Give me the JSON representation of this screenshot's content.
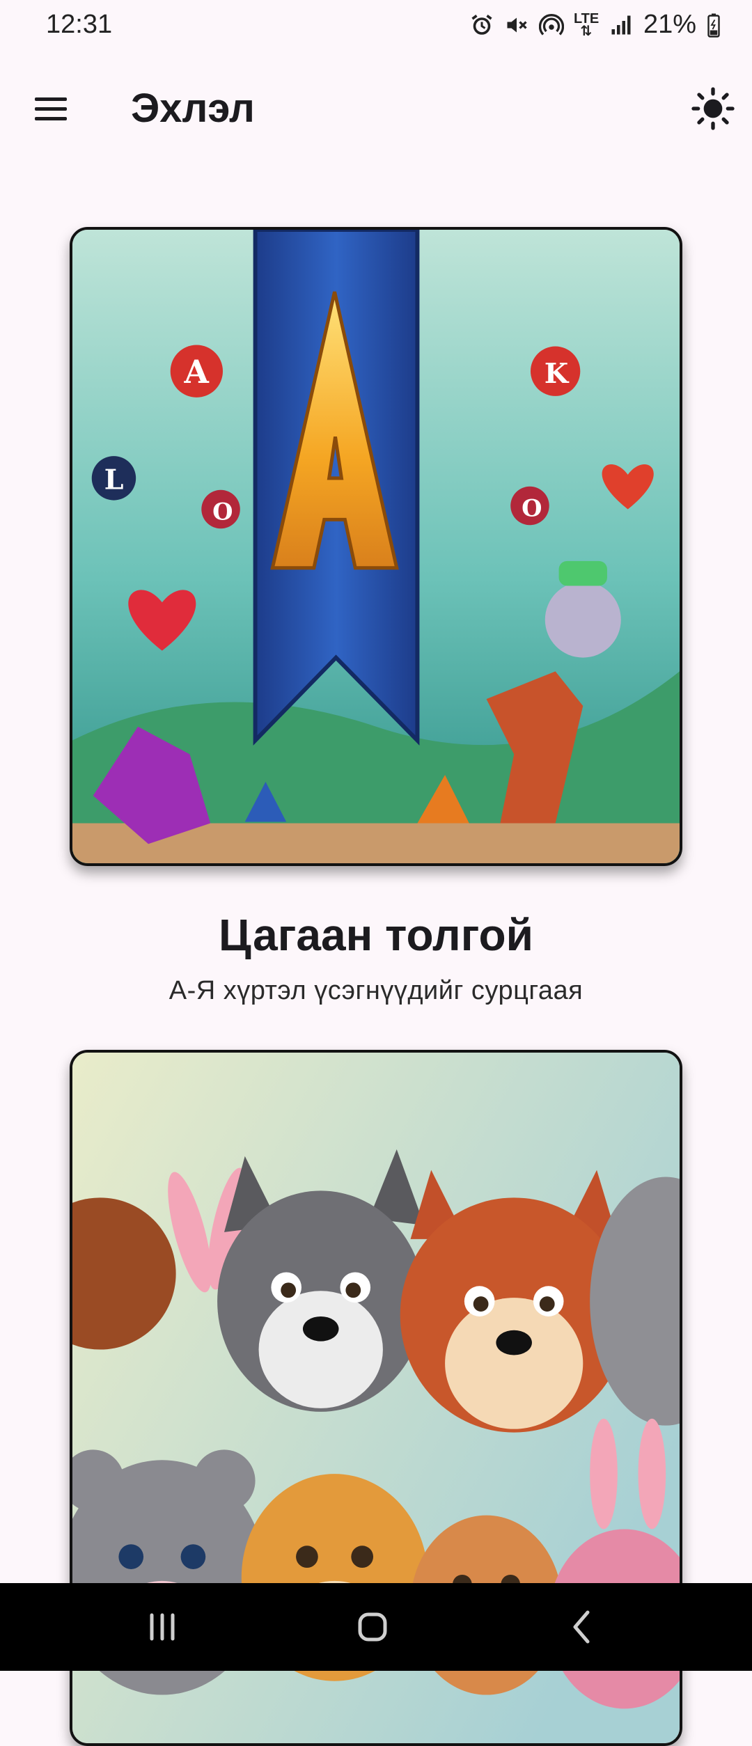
{
  "status_bar": {
    "time": "12:31",
    "battery": "21%",
    "network": "LTE",
    "icons": [
      "alarm-icon",
      "mute-icon",
      "hotspot-icon",
      "lte-icon",
      "signal-icon",
      "battery-icon"
    ]
  },
  "app_bar": {
    "title": "Эхлэл",
    "menu_icon": "hamburger-menu-icon",
    "theme_icon": "sun-icon"
  },
  "cards": [
    {
      "title": "Цагаан толгой",
      "subtitle": "А-Я хүртэл үсэгнүүдийг сурцгаая",
      "image": "alphabet-letter-a-banner-illustration"
    },
    {
      "image": "cartoon-animals-illustration"
    }
  ],
  "nav_bar": {
    "icons": [
      "recent-apps-icon",
      "home-icon",
      "back-icon"
    ]
  },
  "colors": {
    "background": "#fdf7fb",
    "card_border": "#121212",
    "nav_bar": "#000000"
  }
}
